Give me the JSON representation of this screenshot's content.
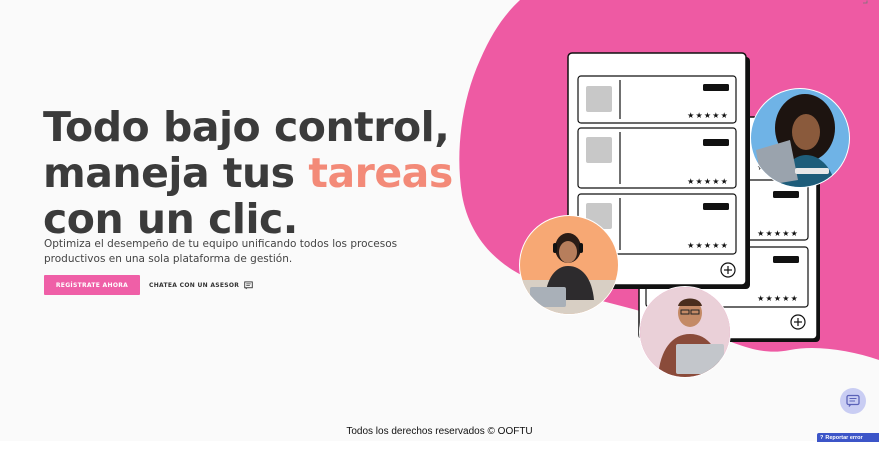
{
  "hero": {
    "title_line1": "Todo bajo control,",
    "title_line2_prefix": "maneja tus ",
    "title_line2_accent": "tareas",
    "title_line3": "con un clic.",
    "subtitle": "Optimiza el desempeño de tu equipo unificando todos los procesos productivos en una sola plataforma de gestión.",
    "register_button": "REGÍSTRATE AHORA",
    "chat_button": "CHATEA CON UN ASESOR"
  },
  "illustration": {
    "task_cards": [
      {
        "rating_stars": 5
      },
      {
        "rating_stars": 5
      },
      {
        "rating_stars": 5
      }
    ],
    "back_card_rows": [
      {
        "rating_stars": 5
      },
      {
        "rating_stars": 5
      },
      {
        "rating_stars": 5
      }
    ],
    "star_glyph": "★★★★★"
  },
  "footer": {
    "copyright": "Todos los derechos reservados © OOFTU"
  },
  "widgets": {
    "report_label": "Reportar error"
  },
  "colors": {
    "brand_pink": "#ef5fa7",
    "accent_coral": "#f38a78",
    "title_gray": "#3b3b3b",
    "blob_pink": "#ee5aa3",
    "report_blue": "#3c55c8"
  }
}
